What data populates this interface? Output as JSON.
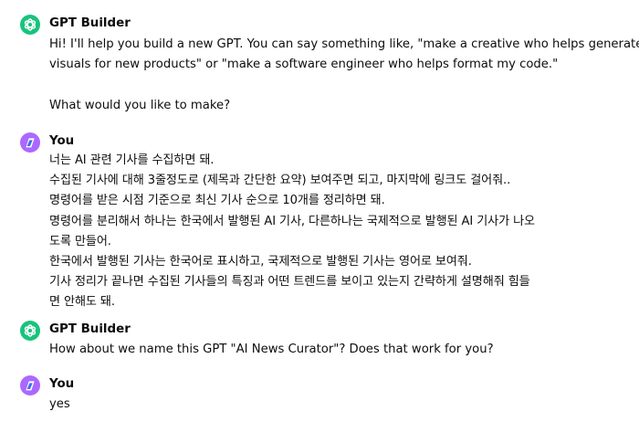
{
  "messages": [
    {
      "sender": "GPT Builder",
      "avatar": "gpt-builder-logo-icon",
      "lines": [
        "Hi! I'll help you build a new GPT. You can say something like, \"make a creative who helps generate",
        "visuals for new products\" or \"make a software engineer who helps format my code.\"",
        "",
        "What would you like to make?"
      ]
    },
    {
      "sender": "You",
      "avatar": "user-avatar-icon",
      "lines": [
        "너는 AI 관련 기사를 수집하면 돼.",
        "수집된 기사에 대해 3줄정도로 (제목과 간단한 요약) 보여주면 되고, 마지막에 링크도 걸어줘..",
        "명령어를 받은 시점 기준으로 최신 기사 순으로 10개를 정리하면 돼.",
        "명령어를 분리해서 하나는 한국에서 발행된 AI 기사, 다른하나는 국제적으로 발행된 AI 기사가 나오",
        "도록 만들어.",
        "한국에서 발행된 기사는 한국어로 표시하고, 국제적으로 발행된 기사는 영어로 보여줘.",
        "기사 정리가 끝나면 수집된 기사들의 특징과 어떤 트렌드를 보이고 있는지 간략하게 설명해줘 힘들",
        "면 안해도 돼."
      ]
    },
    {
      "sender": "GPT Builder",
      "avatar": "gpt-builder-logo-icon",
      "lines": [
        "How about we name this GPT \"AI News Curator\"? Does that work for you?"
      ]
    },
    {
      "sender": "You",
      "avatar": "user-avatar-icon",
      "lines": [
        "yes"
      ]
    }
  ],
  "colors": {
    "gpt_avatar_bg": "#19c37d",
    "user_avatar_bg": "#ab68ff",
    "text": "#0d0d0d"
  }
}
